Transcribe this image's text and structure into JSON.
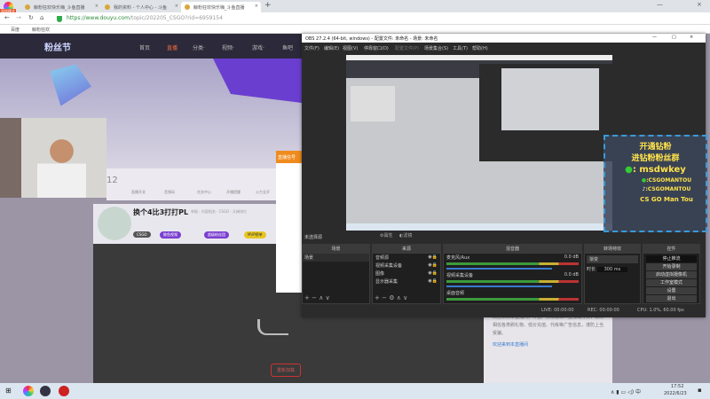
{
  "browser": {
    "tabs": [
      {
        "label": "鲸粉狂欢快乐嗨_斗鱼直播"
      },
      {
        "label": "我的资料 - 个人中心 - 斗鱼"
      },
      {
        "label": "鲸粉狂欢快乐嗨_斗鱼直播"
      }
    ],
    "badge": "双核模式",
    "url_host": "https://www.douyu.com",
    "url_path": "/topic/202205_CSGO?rid=6959154",
    "bookmarks": [
      "百度",
      "鲸粉狂欢"
    ]
  },
  "douyu": {
    "logo": "粉丝节",
    "nav": [
      "首页",
      "直播",
      "分类·",
      "视频·",
      "游戏·",
      "鱼吧"
    ],
    "info_items": [
      "直播开关",
      "音频码",
      "任务中心",
      "开播提醒",
      "火力全开"
    ],
    "level": "12",
    "title": "换个4比3打打PL",
    "meta": "举报 · 内容相关 · CSGO · 天梯排位",
    "tags": [
      "CSGO",
      "鲸鱼视频",
      "超级粉丝团",
      "MVP榜单"
    ],
    "video_button": "重新加载",
    "chat_text": "欢迎来到本直播间，斗鱼严禁未成年人直播或打赏，请勿相信各类刷礼物、低价充值、代练等广告信息，谨防上当受骗。",
    "chat_user": "欢迎来到本直播间",
    "popup_header": "直播信号"
  },
  "obs": {
    "title": "OBS 27.2.4 (64-bit, windows) - 配置文件: 未命名 - 场景: 未命名",
    "menu": [
      "文件(F)",
      "编辑(E)",
      "视图(V)",
      "停靠窗口(D)",
      "配置文件(P)",
      "场景集合(S)",
      "工具(T)",
      "帮助(H)"
    ],
    "no_source": "未选择源",
    "props": "属性",
    "filters": "滤镜",
    "panels": {
      "scenes": "场景",
      "sources": "来源",
      "mixer": "混音器",
      "transitions": "转场特效",
      "controls": "控件"
    },
    "scene_items": [
      "场景"
    ],
    "source_items": [
      "音频源",
      "视频采集设备",
      "图像",
      "显示器采集"
    ],
    "mixer_tracks": [
      {
        "name": "麦克风/Aux",
        "db": "0.0 dB"
      },
      {
        "name": "视频采集设备",
        "db": "0.0 dB"
      },
      {
        "name": "桌面音频",
        "db": ""
      }
    ],
    "transition": "渐变",
    "duration_label": "时长",
    "duration": "300 ms",
    "controls": [
      "停止推流",
      "开始录制",
      "启动虚拟摄像机",
      "工作室模式",
      "设置",
      "退出"
    ],
    "status": {
      "live": "LIVE: 00:00:00",
      "rec": "REC: 00:00:00",
      "cpu": "CPU: 1.0%, 60.00 fps"
    }
  },
  "overlay": {
    "lines": [
      "开通钻粉",
      "进钻粉粉丝群"
    ],
    "wechat": ": msdwkey",
    "weibo": ":CSGOMANTOU",
    "douyin": ":CSGOMANTOU",
    "name": "CS GO Man Tou"
  },
  "taskbar": {
    "time": "17:52",
    "date": "2022/6/23"
  }
}
